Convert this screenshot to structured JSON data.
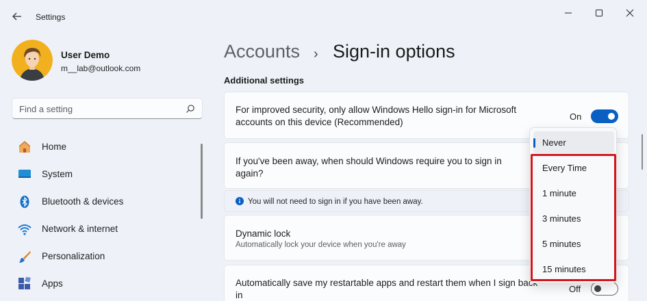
{
  "app": {
    "title": "Settings"
  },
  "user": {
    "name": "User Demo",
    "email": "m__lab@outlook.com"
  },
  "search": {
    "placeholder": "Find a setting"
  },
  "nav": {
    "items": [
      {
        "label": "Home",
        "icon": "home-icon"
      },
      {
        "label": "System",
        "icon": "system-icon"
      },
      {
        "label": "Bluetooth & devices",
        "icon": "bluetooth-icon"
      },
      {
        "label": "Network & internet",
        "icon": "wifi-icon"
      },
      {
        "label": "Personalization",
        "icon": "brush-icon"
      },
      {
        "label": "Apps",
        "icon": "apps-icon"
      }
    ]
  },
  "breadcrumb": {
    "parent": "Accounts",
    "separator": "›",
    "current": "Sign-in options"
  },
  "section": {
    "title": "Additional settings"
  },
  "cards": {
    "hello_only": {
      "line1": "For improved security, only allow Windows Hello sign-in for Microsoft",
      "line2": "accounts on this device (Recommended)",
      "toggle_label": "On",
      "toggle_state": true
    },
    "require_signin": {
      "line1": "If you've been away, when should Windows require you to sign in",
      "line2": "again?"
    },
    "info": {
      "text": "You will not need to sign in if you have been away."
    },
    "dynamic_lock": {
      "title": "Dynamic lock",
      "subtitle": "Automatically lock your device when you're away"
    },
    "restart_apps": {
      "line1": "Automatically save my restartable apps and restart them when I sign back",
      "line2": "in",
      "toggle_label": "Off",
      "toggle_state": false
    }
  },
  "dropdown": {
    "selected": "Never",
    "options": [
      "Never",
      "Every Time",
      "1 minute",
      "3 minutes",
      "5 minutes",
      "15 minutes"
    ]
  },
  "colors": {
    "accent": "#0a5fc2",
    "highlight": "#d4161c"
  }
}
